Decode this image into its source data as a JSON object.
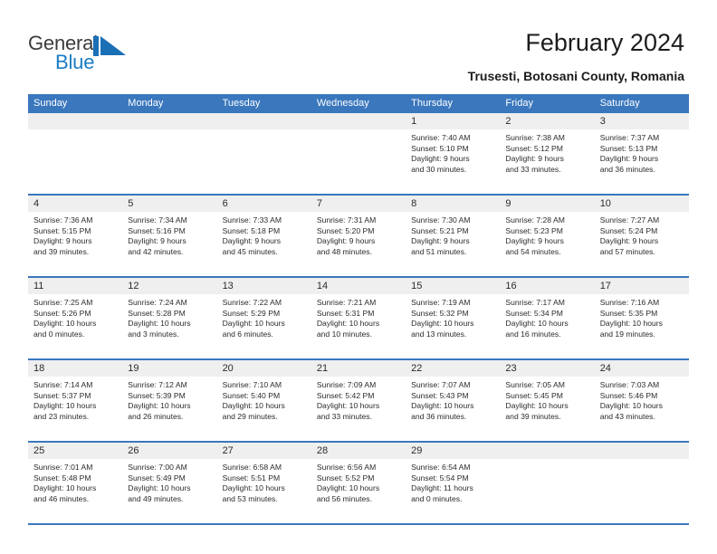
{
  "brand": {
    "name_part1": "General",
    "name_part2": "Blue",
    "mark": "triangle-flag-icon",
    "accent_color": "#1a7dc4",
    "text_color": "#3c3c3c"
  },
  "header": {
    "title": "February 2024",
    "location": "Trusesti, Botosani County, Romania",
    "header_bg_color": "#3a77bd",
    "header_text_color": "#ffffff",
    "date_strip_color": "#efefef"
  },
  "weekdays": [
    "Sunday",
    "Monday",
    "Tuesday",
    "Wednesday",
    "Thursday",
    "Friday",
    "Saturday"
  ],
  "labels": {
    "sunrise_prefix": "Sunrise:",
    "sunset_prefix": "Sunset:",
    "daylight_prefix": "Daylight:"
  },
  "weeks": [
    [
      {
        "day": "",
        "empty": true
      },
      {
        "day": "",
        "empty": true
      },
      {
        "day": "",
        "empty": true
      },
      {
        "day": "",
        "empty": true
      },
      {
        "day": "1",
        "sunrise": "Sunrise: 7:40 AM",
        "sunset": "Sunset: 5:10 PM",
        "daylight1": "Daylight: 9 hours",
        "daylight2": "and 30 minutes."
      },
      {
        "day": "2",
        "sunrise": "Sunrise: 7:38 AM",
        "sunset": "Sunset: 5:12 PM",
        "daylight1": "Daylight: 9 hours",
        "daylight2": "and 33 minutes."
      },
      {
        "day": "3",
        "sunrise": "Sunrise: 7:37 AM",
        "sunset": "Sunset: 5:13 PM",
        "daylight1": "Daylight: 9 hours",
        "daylight2": "and 36 minutes."
      }
    ],
    [
      {
        "day": "4",
        "sunrise": "Sunrise: 7:36 AM",
        "sunset": "Sunset: 5:15 PM",
        "daylight1": "Daylight: 9 hours",
        "daylight2": "and 39 minutes."
      },
      {
        "day": "5",
        "sunrise": "Sunrise: 7:34 AM",
        "sunset": "Sunset: 5:16 PM",
        "daylight1": "Daylight: 9 hours",
        "daylight2": "and 42 minutes."
      },
      {
        "day": "6",
        "sunrise": "Sunrise: 7:33 AM",
        "sunset": "Sunset: 5:18 PM",
        "daylight1": "Daylight: 9 hours",
        "daylight2": "and 45 minutes."
      },
      {
        "day": "7",
        "sunrise": "Sunrise: 7:31 AM",
        "sunset": "Sunset: 5:20 PM",
        "daylight1": "Daylight: 9 hours",
        "daylight2": "and 48 minutes."
      },
      {
        "day": "8",
        "sunrise": "Sunrise: 7:30 AM",
        "sunset": "Sunset: 5:21 PM",
        "daylight1": "Daylight: 9 hours",
        "daylight2": "and 51 minutes."
      },
      {
        "day": "9",
        "sunrise": "Sunrise: 7:28 AM",
        "sunset": "Sunset: 5:23 PM",
        "daylight1": "Daylight: 9 hours",
        "daylight2": "and 54 minutes."
      },
      {
        "day": "10",
        "sunrise": "Sunrise: 7:27 AM",
        "sunset": "Sunset: 5:24 PM",
        "daylight1": "Daylight: 9 hours",
        "daylight2": "and 57 minutes."
      }
    ],
    [
      {
        "day": "11",
        "sunrise": "Sunrise: 7:25 AM",
        "sunset": "Sunset: 5:26 PM",
        "daylight1": "Daylight: 10 hours",
        "daylight2": "and 0 minutes."
      },
      {
        "day": "12",
        "sunrise": "Sunrise: 7:24 AM",
        "sunset": "Sunset: 5:28 PM",
        "daylight1": "Daylight: 10 hours",
        "daylight2": "and 3 minutes."
      },
      {
        "day": "13",
        "sunrise": "Sunrise: 7:22 AM",
        "sunset": "Sunset: 5:29 PM",
        "daylight1": "Daylight: 10 hours",
        "daylight2": "and 6 minutes."
      },
      {
        "day": "14",
        "sunrise": "Sunrise: 7:21 AM",
        "sunset": "Sunset: 5:31 PM",
        "daylight1": "Daylight: 10 hours",
        "daylight2": "and 10 minutes."
      },
      {
        "day": "15",
        "sunrise": "Sunrise: 7:19 AM",
        "sunset": "Sunset: 5:32 PM",
        "daylight1": "Daylight: 10 hours",
        "daylight2": "and 13 minutes."
      },
      {
        "day": "16",
        "sunrise": "Sunrise: 7:17 AM",
        "sunset": "Sunset: 5:34 PM",
        "daylight1": "Daylight: 10 hours",
        "daylight2": "and 16 minutes."
      },
      {
        "day": "17",
        "sunrise": "Sunrise: 7:16 AM",
        "sunset": "Sunset: 5:35 PM",
        "daylight1": "Daylight: 10 hours",
        "daylight2": "and 19 minutes."
      }
    ],
    [
      {
        "day": "18",
        "sunrise": "Sunrise: 7:14 AM",
        "sunset": "Sunset: 5:37 PM",
        "daylight1": "Daylight: 10 hours",
        "daylight2": "and 23 minutes."
      },
      {
        "day": "19",
        "sunrise": "Sunrise: 7:12 AM",
        "sunset": "Sunset: 5:39 PM",
        "daylight1": "Daylight: 10 hours",
        "daylight2": "and 26 minutes."
      },
      {
        "day": "20",
        "sunrise": "Sunrise: 7:10 AM",
        "sunset": "Sunset: 5:40 PM",
        "daylight1": "Daylight: 10 hours",
        "daylight2": "and 29 minutes."
      },
      {
        "day": "21",
        "sunrise": "Sunrise: 7:09 AM",
        "sunset": "Sunset: 5:42 PM",
        "daylight1": "Daylight: 10 hours",
        "daylight2": "and 33 minutes."
      },
      {
        "day": "22",
        "sunrise": "Sunrise: 7:07 AM",
        "sunset": "Sunset: 5:43 PM",
        "daylight1": "Daylight: 10 hours",
        "daylight2": "and 36 minutes."
      },
      {
        "day": "23",
        "sunrise": "Sunrise: 7:05 AM",
        "sunset": "Sunset: 5:45 PM",
        "daylight1": "Daylight: 10 hours",
        "daylight2": "and 39 minutes."
      },
      {
        "day": "24",
        "sunrise": "Sunrise: 7:03 AM",
        "sunset": "Sunset: 5:46 PM",
        "daylight1": "Daylight: 10 hours",
        "daylight2": "and 43 minutes."
      }
    ],
    [
      {
        "day": "25",
        "sunrise": "Sunrise: 7:01 AM",
        "sunset": "Sunset: 5:48 PM",
        "daylight1": "Daylight: 10 hours",
        "daylight2": "and 46 minutes."
      },
      {
        "day": "26",
        "sunrise": "Sunrise: 7:00 AM",
        "sunset": "Sunset: 5:49 PM",
        "daylight1": "Daylight: 10 hours",
        "daylight2": "and 49 minutes."
      },
      {
        "day": "27",
        "sunrise": "Sunrise: 6:58 AM",
        "sunset": "Sunset: 5:51 PM",
        "daylight1": "Daylight: 10 hours",
        "daylight2": "and 53 minutes."
      },
      {
        "day": "28",
        "sunrise": "Sunrise: 6:56 AM",
        "sunset": "Sunset: 5:52 PM",
        "daylight1": "Daylight: 10 hours",
        "daylight2": "and 56 minutes."
      },
      {
        "day": "29",
        "sunrise": "Sunrise: 6:54 AM",
        "sunset": "Sunset: 5:54 PM",
        "daylight1": "Daylight: 11 hours",
        "daylight2": "and 0 minutes."
      },
      {
        "day": "",
        "empty": true
      },
      {
        "day": "",
        "empty": true
      }
    ]
  ]
}
